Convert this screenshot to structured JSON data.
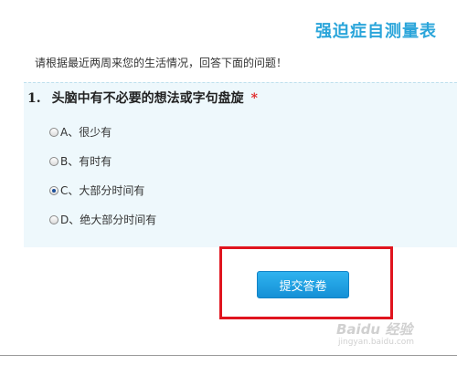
{
  "header": {
    "title": "强迫症自测量表"
  },
  "intro_text": "请根据最近两周来您的生活情况，回答下面的问题！",
  "question": {
    "number": "1.",
    "text": "头脑中有不必要的想法或字句盘旋",
    "required_mark": "*",
    "options": [
      {
        "label": "A、很少有",
        "checked": false
      },
      {
        "label": "B、有时有",
        "checked": false
      },
      {
        "label": "C、大部分时间有",
        "checked": true
      },
      {
        "label": "D、绝大部分时间有",
        "checked": false
      }
    ]
  },
  "submit": {
    "label": "提交答卷"
  },
  "watermark": {
    "main": "Baidu 经验",
    "sub": "jingyan.baidu.com"
  },
  "colors": {
    "accent": "#2aa5da",
    "panel_bg": "#eef8fc",
    "highlight": "#e0141e",
    "required": "#e02020"
  }
}
